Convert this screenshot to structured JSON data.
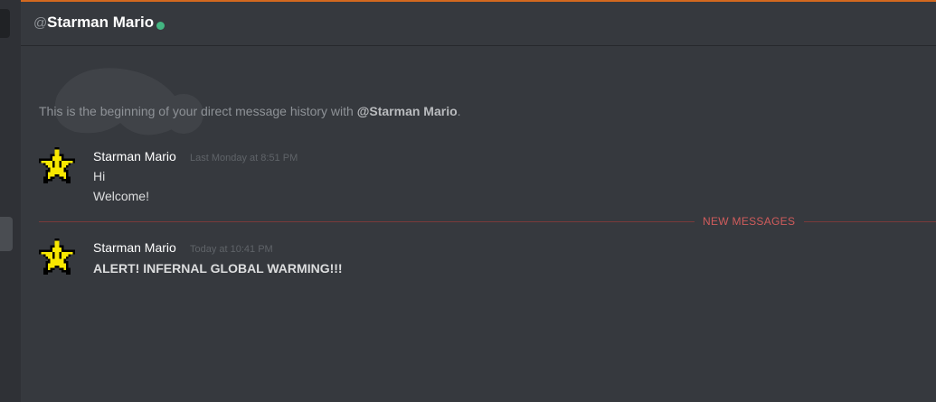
{
  "header": {
    "at_symbol": "@",
    "username": "Starman Mario",
    "status": "online",
    "status_color": "#43b581"
  },
  "intro": {
    "prefix": "This is the beginning of your direct message history with ",
    "mention": "@Starman Mario",
    "suffix": "."
  },
  "messages": [
    {
      "author": "Starman Mario",
      "timestamp": "Last Monday at 8:51 PM",
      "lines": [
        "Hi",
        "Welcome!"
      ]
    },
    {
      "author": "Starman Mario",
      "timestamp": "Today at 10:41 PM",
      "lines": [
        "ALERT! INFERNAL GLOBAL WARMING!!!"
      ]
    }
  ],
  "divider": {
    "label": "NEW MESSAGES",
    "color": "#d05c5c"
  },
  "avatar_icon": "pixel-star-icon",
  "colors": {
    "accent_bar": "#d3691f",
    "background": "#36393e",
    "sidebar": "#2f3136"
  }
}
